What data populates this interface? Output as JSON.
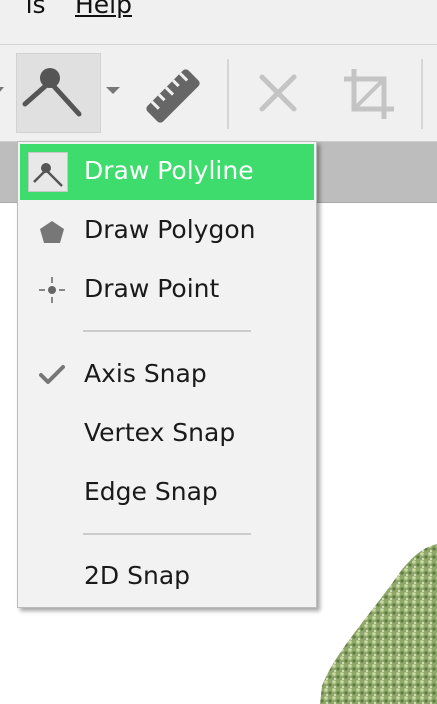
{
  "menubar": {
    "tools_label": "Tools",
    "help_label": "Help"
  },
  "toolbar": {
    "buttons": [
      {
        "name": "polyline-tool-icon",
        "active": true
      },
      {
        "name": "ruler-icon"
      },
      {
        "name": "delete-icon"
      },
      {
        "name": "crop-icon"
      }
    ]
  },
  "dropdown": {
    "items": [
      {
        "label": "Draw Polyline",
        "icon": "polyline-icon",
        "highlighted": true
      },
      {
        "label": "Draw Polygon",
        "icon": "polygon-icon"
      },
      {
        "label": "Draw Point",
        "icon": "point-icon"
      },
      {
        "label": "Axis Snap",
        "icon": "checkmark-icon",
        "checked": true
      },
      {
        "label": "Vertex Snap",
        "checked": false
      },
      {
        "label": "Edge Snap",
        "checked": false
      },
      {
        "label": "2D Snap",
        "checked": false
      }
    ]
  },
  "colors": {
    "highlight": "#3ddc6c",
    "toolbar_bg": "#f0f0f0",
    "menu_bg": "#f2f2f2"
  }
}
